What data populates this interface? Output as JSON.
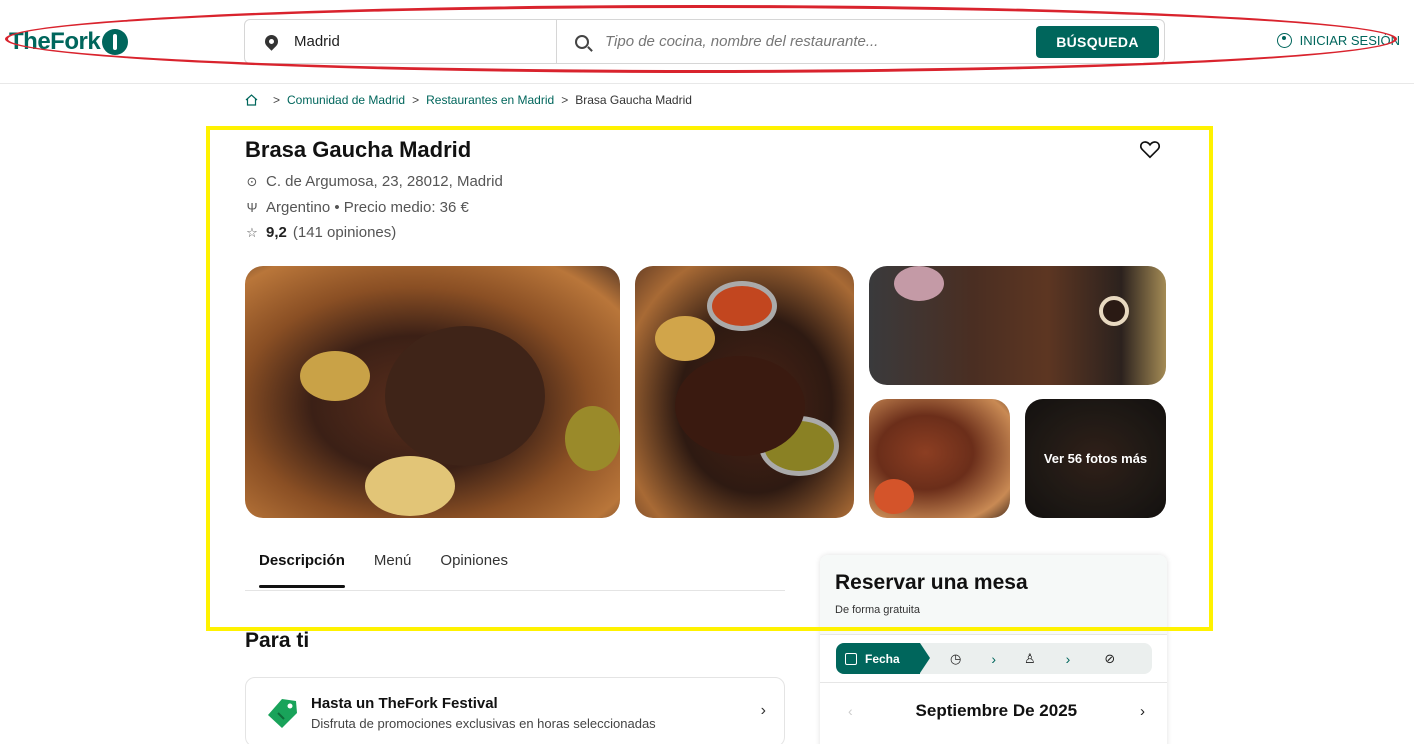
{
  "header": {
    "logo_text": "TheFork",
    "location_value": "Madrid",
    "search_placeholder": "Tipo de cocina, nombre del restaurante...",
    "search_button": "BÚSQUEDA",
    "login_label": "INICIAR SESIÓN"
  },
  "breadcrumb": {
    "items": [
      "Comunidad de Madrid",
      "Restaurantes en Madrid"
    ],
    "current": "Brasa Gaucha Madrid"
  },
  "restaurant": {
    "name": "Brasa Gaucha Madrid",
    "address": "C. de Argumosa, 23, 28012, Madrid",
    "cuisine_price": "Argentino • Precio medio: 36 €",
    "rating": "9,2",
    "reviews": "(141 opiniones)"
  },
  "gallery": {
    "more_photos": "Ver 56 fotos más"
  },
  "tabs": [
    {
      "label": "Descripción",
      "active": true
    },
    {
      "label": "Menú",
      "active": false
    },
    {
      "label": "Opiniones",
      "active": false
    }
  ],
  "booking": {
    "title": "Reservar una mesa",
    "subtitle": "De forma gratuita",
    "active_step": "Fecha",
    "month": "Septiembre De 2025"
  },
  "para_ti": {
    "heading": "Para ti",
    "promo_title": "Hasta un TheFork Festival",
    "promo_subtitle": "Disfruta de promociones exclusivas en horas seleccionadas"
  },
  "colors": {
    "brand": "#00665c",
    "annotation_red": "#d9232d",
    "annotation_yellow": "#fff200"
  }
}
